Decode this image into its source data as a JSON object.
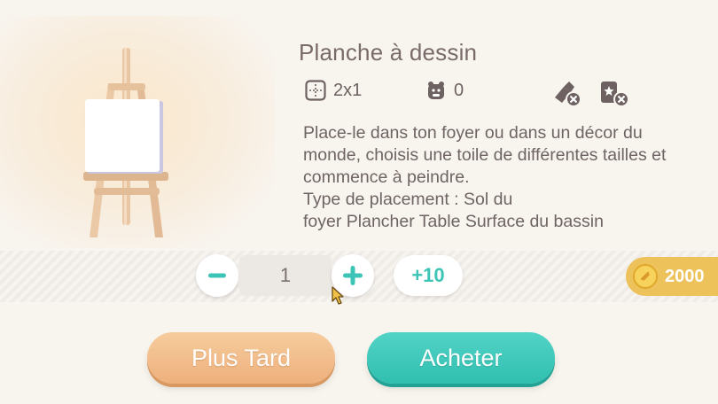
{
  "item": {
    "title": "Planche à dessin",
    "description": "Place-le dans ton foyer ou dans un décor du monde, choisis une toile de différentes tailles et commence à peindre.\nType de placement : Sol du\nfoyer Plancher Table Surface du bassin"
  },
  "stats": {
    "size_icon": "grid-size-icon",
    "size": "2x1",
    "comfort_icon": "bear-comfort-icon",
    "comfort": "0",
    "flag1_icon": "no-brush-icon",
    "flag2_icon": "no-sticker-icon"
  },
  "quantity": {
    "minus_icon": "minus-icon",
    "value": "1",
    "plus_icon": "plus-icon",
    "plus10_label": "+10"
  },
  "price": {
    "currency_icon": "gold-coin-icon",
    "value": "2000"
  },
  "buttons": {
    "later_label": "Plus Tard",
    "buy_label": "Acheter"
  },
  "colors": {
    "accent_teal": "#3cc4b6",
    "later_orange": "#f0b886",
    "gold": "#eec25a",
    "text": "#6f6464"
  }
}
